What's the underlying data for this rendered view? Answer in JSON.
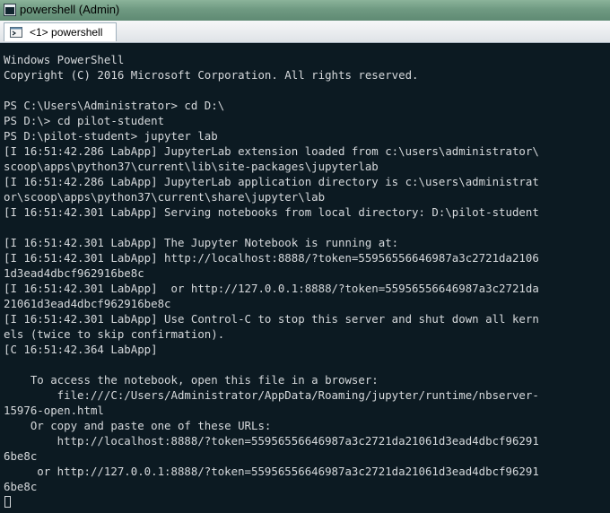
{
  "window": {
    "title": "powershell (Admin)",
    "tab_label": "<1> powershell",
    "colors": {
      "titlebar": "#6f9a82",
      "console_background": "#0c1a22",
      "console_text": "#d6d9dc"
    }
  },
  "console": {
    "lines": [
      "Windows PowerShell",
      "Copyright (C) 2016 Microsoft Corporation. All rights reserved.",
      "",
      "PS C:\\Users\\Administrator> cd D:\\",
      "PS D:\\> cd pilot-student",
      "PS D:\\pilot-student> jupyter lab",
      "[I 16:51:42.286 LabApp] JupyterLab extension loaded from c:\\users\\administrator\\",
      "scoop\\apps\\python37\\current\\lib\\site-packages\\jupyterlab",
      "[I 16:51:42.286 LabApp] JupyterLab application directory is c:\\users\\administrat",
      "or\\scoop\\apps\\python37\\current\\share\\jupyter\\lab",
      "[I 16:51:42.301 LabApp] Serving notebooks from local directory: D:\\pilot-student",
      "",
      "[I 16:51:42.301 LabApp] The Jupyter Notebook is running at:",
      "[I 16:51:42.301 LabApp] http://localhost:8888/?token=55956556646987a3c2721da2106",
      "1d3ead4dbcf962916be8c",
      "[I 16:51:42.301 LabApp]  or http://127.0.0.1:8888/?token=55956556646987a3c2721da",
      "21061d3ead4dbcf962916be8c",
      "[I 16:51:42.301 LabApp] Use Control-C to stop this server and shut down all kern",
      "els (twice to skip confirmation).",
      "[C 16:51:42.364 LabApp]",
      "",
      "    To access the notebook, open this file in a browser:",
      "        file:///C:/Users/Administrator/AppData/Roaming/jupyter/runtime/nbserver-",
      "15976-open.html",
      "    Or copy and paste one of these URLs:",
      "        http://localhost:8888/?token=55956556646987a3c2721da21061d3ead4dbcf96291",
      "6be8c",
      "     or http://127.0.0.1:8888/?token=55956556646987a3c2721da21061d3ead4dbcf96291",
      "6be8c"
    ]
  }
}
